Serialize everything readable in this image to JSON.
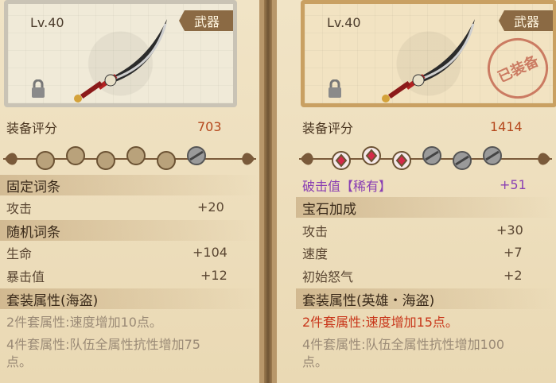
{
  "left": {
    "level": "Lv.40",
    "type": "武器",
    "score_label": "装备评分",
    "score_value": "703",
    "fixed_header": "固定词条",
    "fixed": [
      {
        "label": "攻击",
        "value": "+20"
      }
    ],
    "random_header": "随机词条",
    "random": [
      {
        "label": "生命",
        "value": "+104"
      },
      {
        "label": "暴击值",
        "value": "+12"
      }
    ],
    "set_header": "套装属性(海盗)",
    "set_lines": [
      "2件套属性:速度增加10点。",
      "4件套属性:队伍全属性抗性增加75",
      "点。"
    ]
  },
  "right": {
    "level": "Lv.40",
    "type": "武器",
    "stamp": "已装备",
    "score_label": "装备评分",
    "score_value": "1414",
    "rare_row": {
      "label": "破击值【稀有】",
      "value": "+51"
    },
    "gem_header": "宝石加成",
    "gems": [
      {
        "label": "攻击",
        "value": "+30"
      },
      {
        "label": "速度",
        "value": "+7"
      },
      {
        "label": "初始怒气",
        "value": "+2"
      }
    ],
    "set_header": "套装属性(英雄・海盗)",
    "set_lines": [
      "2件套属性:速度增加15点。",
      "4件套属性:队伍全属性抗性增加100",
      "点。"
    ]
  },
  "colors": {
    "score": "#b5471c",
    "active_set": "#c8361a",
    "rare": "#8a3fb3"
  }
}
